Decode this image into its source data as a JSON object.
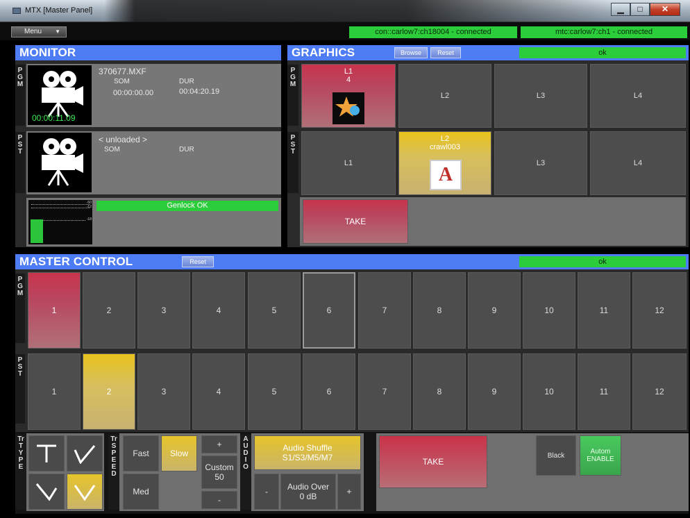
{
  "window": {
    "title": "MTX [Master Panel]",
    "min": "▁",
    "max": "□",
    "close": "✕"
  },
  "menu": {
    "label": "Menu"
  },
  "status": {
    "con": "con::carlow7:ch18004 - connected",
    "mtc": "mtc:carlow7:ch1 - connected",
    "color": "#2ccd3b"
  },
  "monitor": {
    "title": "MONITOR",
    "pgm_label": "PGM",
    "pst_label": "PST",
    "pgm": {
      "filename": "370677.MXF",
      "som_label": "SOM",
      "dur_label": "DUR",
      "som": "00:00:00.00",
      "dur": "00:04:20.19",
      "timecode": "00:00:11.09"
    },
    "pst": {
      "filename": "< unloaded >",
      "som_label": "SOM",
      "dur_label": "DUR"
    },
    "meter_labels": [
      "-50",
      "-12",
      "-18"
    ],
    "genlock": "Genlock OK"
  },
  "graphics": {
    "title": "GRAPHICS",
    "browse": "Browse",
    "reset": "Reset",
    "status": "ok",
    "pgm_label": "PGM",
    "pst_label": "PST",
    "pgm_layers": [
      {
        "label": "L1",
        "sub": "4",
        "state": "red"
      },
      {
        "label": "L2",
        "sub": "",
        "state": "off"
      },
      {
        "label": "L3",
        "sub": "",
        "state": "off"
      },
      {
        "label": "L4",
        "sub": "",
        "state": "off"
      }
    ],
    "pst_layers": [
      {
        "label": "L1",
        "sub": "",
        "state": "off"
      },
      {
        "label": "L2",
        "sub": "crawl003",
        "state": "yellow"
      },
      {
        "label": "L3",
        "sub": "",
        "state": "off"
      },
      {
        "label": "L4",
        "sub": "",
        "state": "off"
      }
    ],
    "take": "TAKE"
  },
  "master": {
    "title": "MASTER CONTROL",
    "reset": "Reset",
    "status": "ok",
    "pgm_label": "PGM",
    "pst_label": "PST",
    "pgm": [
      "1",
      "2",
      "3",
      "4",
      "5",
      "6",
      "7",
      "8",
      "9",
      "10",
      "11",
      "12"
    ],
    "pst": [
      "1",
      "2",
      "3",
      "4",
      "5",
      "6",
      "7",
      "8",
      "9",
      "10",
      "11",
      "12"
    ],
    "pgm_active_index": 0,
    "pgm_outline_index": 5,
    "pst_active_index": 1
  },
  "controls": {
    "tr_type_label": "Tr TYPE",
    "tr_speed_label": "Tr SPEED",
    "audio_label": "AUDIO",
    "fast": "Fast",
    "slow": "Slow",
    "med": "Med",
    "plus": "+",
    "minus": "-",
    "custom": "Custom",
    "custom_value": "50",
    "audio_shuffle": "Audio Shuffle",
    "audio_shuffle_value": "S1/S3/M5/M7",
    "audio_over": "Audio Over",
    "audio_over_value": "0 dB",
    "audio_minus": "-",
    "audio_plus": "+",
    "take": "TAKE",
    "black": "Black",
    "autom": "Autom",
    "enable": "ENABLE"
  }
}
